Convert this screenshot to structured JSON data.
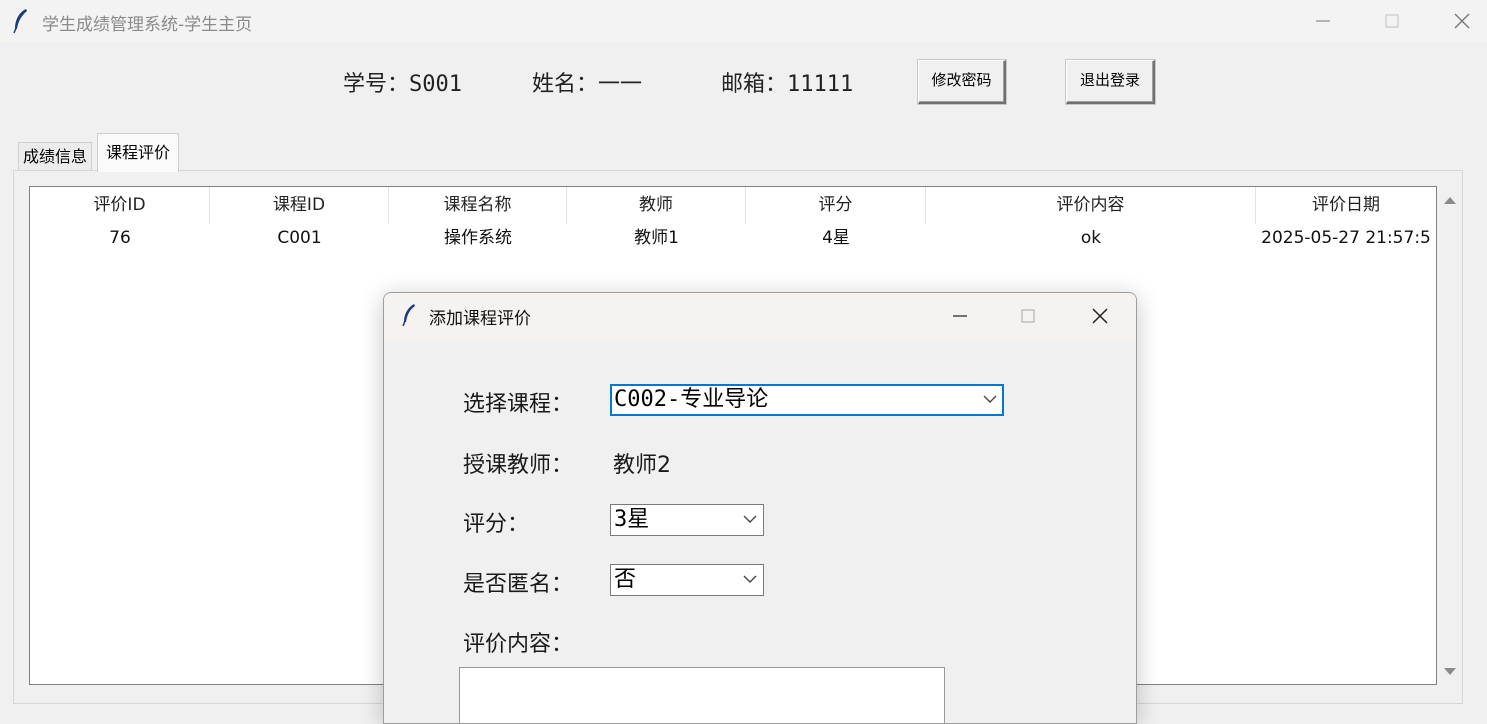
{
  "window": {
    "title": "学生成绩管理系统-学生主页"
  },
  "header": {
    "student_id_label": "学号：",
    "student_id": "S001",
    "name_label": "姓名：",
    "name": "一一",
    "email_label": "邮箱：",
    "email": "11111",
    "change_password_label": "修改密码",
    "logout_label": "退出登录"
  },
  "tabs": [
    {
      "label": "成绩信息",
      "selected": false
    },
    {
      "label": "课程评价",
      "selected": true
    }
  ],
  "table": {
    "columns": [
      "评价ID",
      "课程ID",
      "课程名称",
      "教师",
      "评分",
      "评价内容",
      "评价日期"
    ],
    "rows": [
      [
        "76",
        "C001",
        "操作系统",
        "教师1",
        "4星",
        "ok",
        "2025-05-27 21:57:5"
      ]
    ]
  },
  "dialog": {
    "title": "添加课程评价",
    "course_label": "选择课程：",
    "course_value": "C002-专业导论",
    "teacher_label": "授课教师：",
    "teacher_value": "教师2",
    "rating_label": "评分：",
    "rating_value": "3星",
    "anonymous_label": "是否匿名：",
    "anonymous_value": "否",
    "content_label": "评价内容："
  },
  "icons": {
    "app": "feather-icon",
    "minimize": "minimize-icon",
    "maximize": "maximize-icon",
    "close": "close-icon",
    "dropdown": "chevron-down-icon",
    "scroll_up": "scroll-up-arrow-icon",
    "scroll_down": "scroll-down-arrow-icon"
  }
}
